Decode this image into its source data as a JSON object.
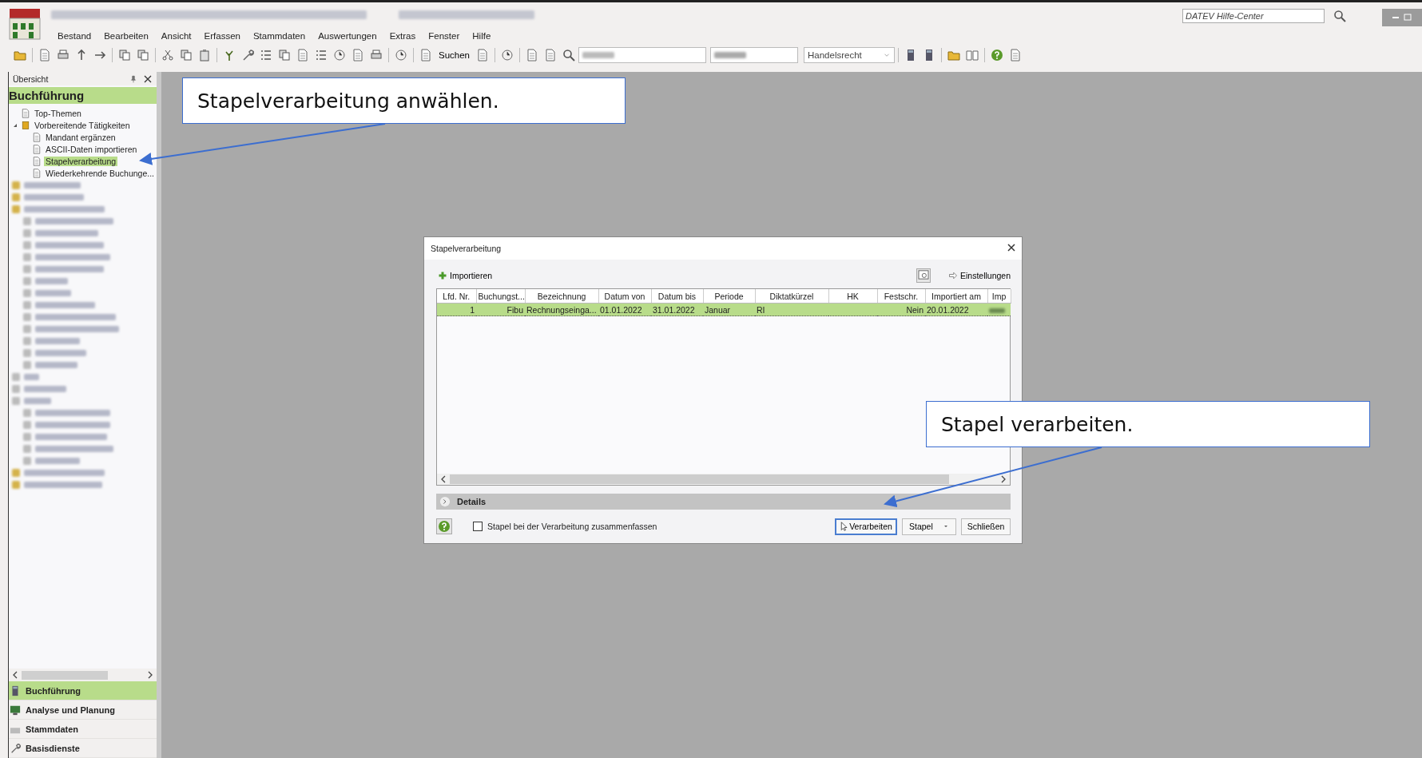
{
  "window": {
    "help_search": {
      "placeholder": "DATEV Hilfe-Center"
    }
  },
  "menu": [
    "Bestand",
    "Bearbeiten",
    "Ansicht",
    "Erfassen",
    "Stammdaten",
    "Auswertungen",
    "Extras",
    "Fenster",
    "Hilfe"
  ],
  "toolbar": {
    "search_label": "Suchen",
    "law_dropdown": "Handelsrecht"
  },
  "sidebar": {
    "title": "Übersicht",
    "section": "Buchführung",
    "tree": [
      {
        "label": "Top-Themen",
        "kind": "page",
        "selected": false
      },
      {
        "label": "Vorbereitende Tätigkeiten",
        "kind": "folder",
        "expanded": true,
        "selected": false,
        "children": [
          {
            "label": "Mandant ergänzen",
            "kind": "page",
            "selected": false
          },
          {
            "label": "ASCII-Daten importieren",
            "kind": "page",
            "selected": false
          },
          {
            "label": "Stapelverarbeitung",
            "kind": "page",
            "selected": true
          },
          {
            "label": "Wiederkehrende Buchunge...",
            "kind": "page",
            "selected": false
          }
        ]
      }
    ],
    "nav": [
      {
        "label": "Buchführung",
        "selected": true
      },
      {
        "label": "Analyse und Planung",
        "selected": false
      },
      {
        "label": "Stammdaten",
        "selected": false
      },
      {
        "label": "Basisdienste",
        "selected": false
      }
    ]
  },
  "dialog": {
    "title": "Stapelverarbeitung",
    "import_label": "Importieren",
    "settings_label": "Einstellungen",
    "columns": [
      "Lfd. Nr.",
      "Buchungst...",
      "Bezeichnung",
      "Datum von",
      "Datum bis",
      "Periode",
      "Diktatkürzel",
      "HK",
      "Festschr.",
      "Importiert am",
      "Imp"
    ],
    "rows": [
      {
        "selected": true,
        "cells": [
          "1",
          "Fibu",
          "Rechnungseinga...",
          "01.01.2022",
          "31.01.2022",
          "Januar",
          "RI",
          null,
          "Nein",
          "20.01.2022"
        ]
      }
    ],
    "details_label": "Details",
    "details_expanded": false,
    "merge_checkbox": {
      "label": "Stapel bei der Verarbeitung zusammenfassen",
      "checked": false
    },
    "buttons": [
      {
        "label": "Verarbeiten",
        "kind": "plain",
        "focused": true
      },
      {
        "label": "Stapel",
        "kind": "split",
        "focused": false
      },
      {
        "label": "Schließen",
        "kind": "plain",
        "focused": false
      }
    ]
  },
  "callouts": [
    {
      "text": "Stapelverarbeitung anwählen."
    },
    {
      "text": "Stapel verarbeiten."
    }
  ]
}
